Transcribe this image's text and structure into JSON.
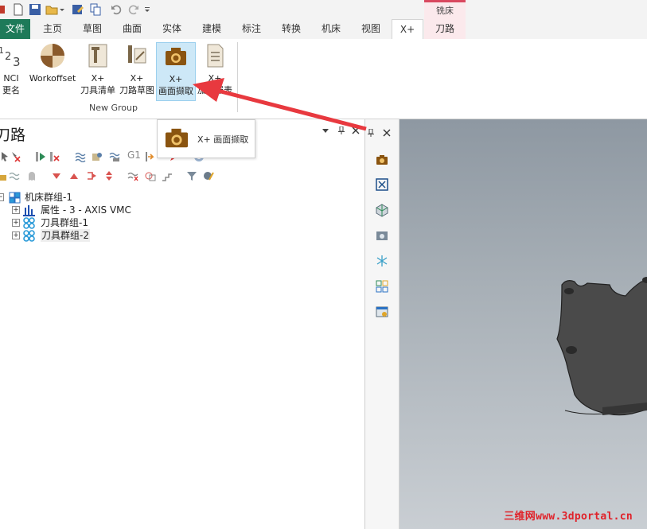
{
  "context_tab": {
    "title": "铣床",
    "tab_label": "刀路",
    "accent": "#d9485f"
  },
  "tabs": [
    {
      "label": "文件"
    },
    {
      "label": "主页"
    },
    {
      "label": "草图"
    },
    {
      "label": "曲面"
    },
    {
      "label": "实体"
    },
    {
      "label": "建模"
    },
    {
      "label": "标注"
    },
    {
      "label": "转换"
    },
    {
      "label": "机床"
    },
    {
      "label": "视图"
    },
    {
      "label": "X+"
    }
  ],
  "ribbon": {
    "buttons": [
      {
        "line1": "NCI",
        "line2": "更名",
        "icon": "numbers-icon"
      },
      {
        "line1": "Workoffset",
        "line2": "",
        "icon": "workoffset-icon"
      },
      {
        "line1": "X+",
        "line2": "刀具清单",
        "icon": "tool-list-icon"
      },
      {
        "line1": "X+",
        "line2": "刀路草图",
        "icon": "toolpath-sketch-icon"
      },
      {
        "line1": "X+",
        "line2": "画面撷取",
        "icon": "camera-icon"
      },
      {
        "line1": "X+",
        "line2": "加工报表",
        "icon": "report-icon"
      }
    ],
    "group_label": "New Group"
  },
  "tooltip": {
    "label": "X+ 画面撷取"
  },
  "panel": {
    "title": "刀路",
    "tree": [
      {
        "label": "机床群组-1",
        "level": 0
      },
      {
        "label": "属性 - 3 - AXIS VMC",
        "level": 1
      },
      {
        "label": "刀具群组-1",
        "level": 1
      },
      {
        "label": "刀具群组-2",
        "level": 1
      }
    ]
  },
  "toolbar_text": {
    "g1": "G1"
  },
  "watermark": "三维网www.3dportal.cn",
  "colors": {
    "file_tab": "#1e7a59",
    "selected": "#cde8f7",
    "arrow": "#e8393f"
  }
}
